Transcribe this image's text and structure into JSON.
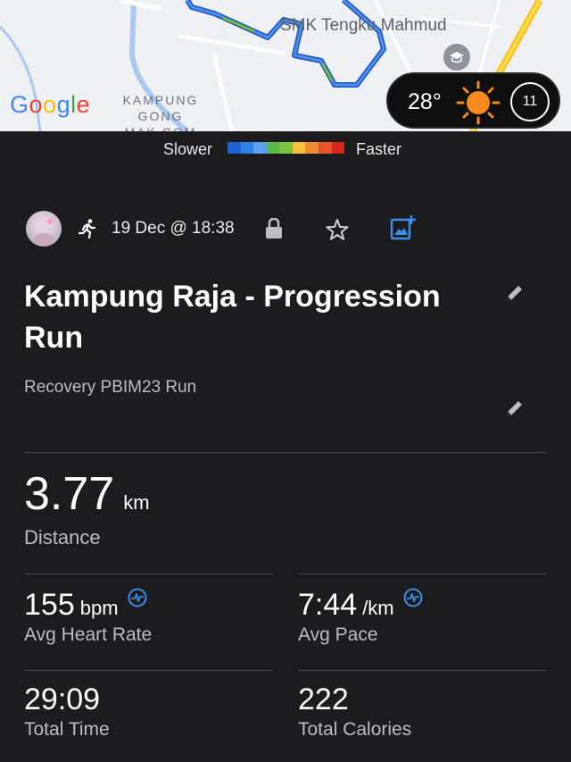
{
  "map": {
    "provider_logo": "Google",
    "school_label": "SMK Tengku Mahmud",
    "area_label_line1": "KAMPUNG",
    "area_label_line2": "GONG",
    "area_label_line3": "MAK COM",
    "route_color": "#3b7ee0",
    "weather": {
      "temperature": "28°",
      "wind_speed": "11",
      "icon": "sun-icon"
    }
  },
  "legend": {
    "slower_label": "Slower",
    "faster_label": "Faster",
    "colors": [
      "#1f5fd8",
      "#2f80e8",
      "#5aa0f0",
      "#58b848",
      "#7cc43c",
      "#f4c23a",
      "#f08a30",
      "#e8552a",
      "#d8261e"
    ]
  },
  "activity": {
    "icon": "running-icon",
    "datetime": "19 Dec @ 18:38",
    "title": "Kampung Raja - Progression Run",
    "description": "Recovery PBIM23 Run"
  },
  "stats": {
    "distance": {
      "value": "3.77",
      "unit": "km",
      "label": "Distance"
    },
    "avg_heart_rate": {
      "value": "155",
      "unit": "bpm",
      "label": "Avg Heart Rate"
    },
    "avg_pace": {
      "value": "7:44",
      "unit": "/km",
      "label": "Avg Pace"
    },
    "total_time": {
      "value": "29:09",
      "label": "Total Time"
    },
    "total_calories": {
      "value": "222",
      "label": "Total Calories"
    }
  },
  "colors": {
    "background": "#1c1c1e",
    "accent": "#3b8eea",
    "muted_text": "#bdbdc0"
  }
}
